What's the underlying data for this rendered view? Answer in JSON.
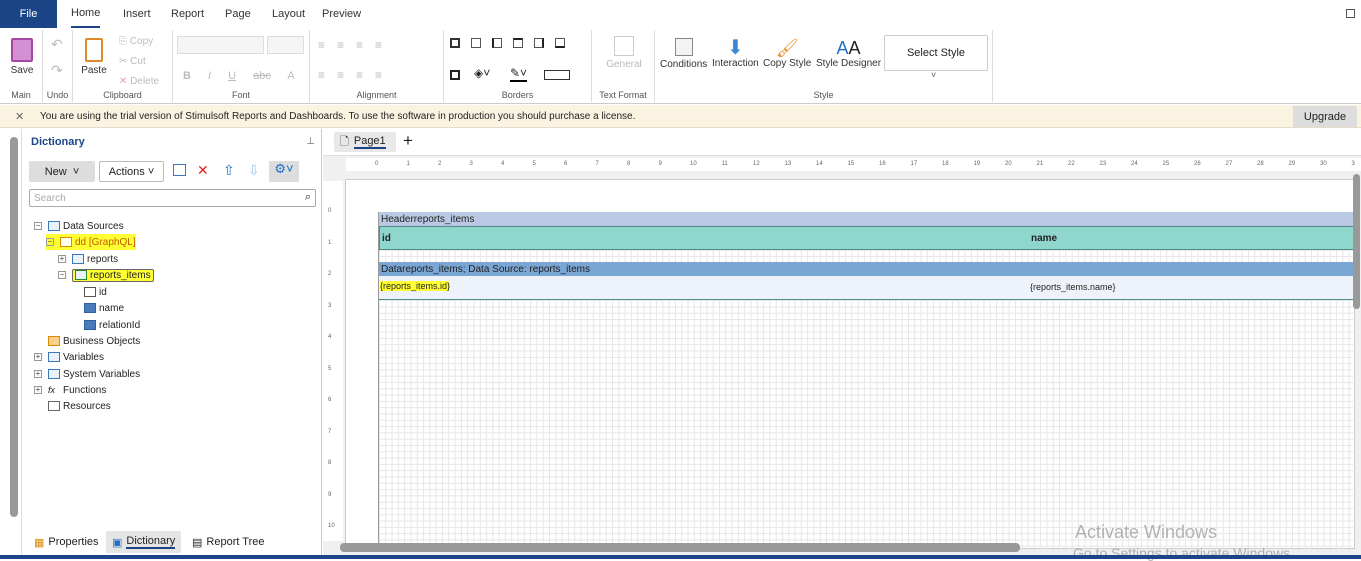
{
  "menu": {
    "file": "File",
    "tabs": [
      "Home",
      "Insert",
      "Report",
      "Page",
      "Layout",
      "Preview"
    ]
  },
  "ribbon": {
    "main": {
      "save": "Save",
      "label": "Main"
    },
    "undo": {
      "label": "Undo"
    },
    "clipboard": {
      "paste": "Paste",
      "copy": "Copy",
      "cut": "Cut",
      "delete": "Delete",
      "label": "Clipboard"
    },
    "font": {
      "label": "Font",
      "bold": "B",
      "italic": "I",
      "underline": "U",
      "strike": "abc",
      "color": "A"
    },
    "alignment": {
      "label": "Alignment"
    },
    "borders": {
      "label": "Borders"
    },
    "text_format": {
      "general": "General",
      "label": "Text Format"
    },
    "style": {
      "conditions": "Conditions",
      "interaction": "Interaction",
      "copy_style": "Copy Style",
      "style_designer": "Style Designer",
      "select_style": "Select Style",
      "label": "Style"
    }
  },
  "trial": {
    "message": "You are using the trial version of Stimulsoft Reports and Dashboards. To use the software in production you should purchase a license.",
    "upgrade": "Upgrade"
  },
  "dictionary": {
    "title": "Dictionary",
    "new": "New",
    "actions": "Actions",
    "search_placeholder": "Search",
    "tree": {
      "data_sources": "Data Sources",
      "connection": "dd [GraphQL]",
      "reports": "reports",
      "reports_items": "reports_items",
      "fields": [
        "id",
        "name",
        "relationId"
      ],
      "business_objects": "Business Objects",
      "variables": "Variables",
      "system_variables": "System Variables",
      "functions": "Functions",
      "resources": "Resources"
    },
    "bottom_tabs": [
      "Properties",
      "Dictionary",
      "Report Tree"
    ]
  },
  "designer": {
    "page_tab": "Page1",
    "ruler_h": [
      "0",
      "1",
      "2",
      "3",
      "4",
      "5",
      "6",
      "7",
      "8",
      "9",
      "10",
      "11",
      "12",
      "13",
      "14",
      "15",
      "16",
      "17",
      "18",
      "19",
      "20",
      "21",
      "22",
      "23",
      "24",
      "25",
      "26",
      "27",
      "28",
      "29",
      "30",
      "3"
    ],
    "ruler_v": [
      "0",
      "1",
      "2",
      "3",
      "4",
      "5",
      "6",
      "7",
      "8",
      "9",
      "10"
    ],
    "header_band": "Headerreports_items",
    "header_cells": [
      "id",
      "name"
    ],
    "data_band": "Datareports_items; Data Source: reports_items",
    "data_cells": [
      "{reports_items.id}",
      "{reports_items.name}"
    ]
  },
  "watermark": {
    "line1": "Activate Windows",
    "line2": "Go to Settings to activate Windows."
  }
}
